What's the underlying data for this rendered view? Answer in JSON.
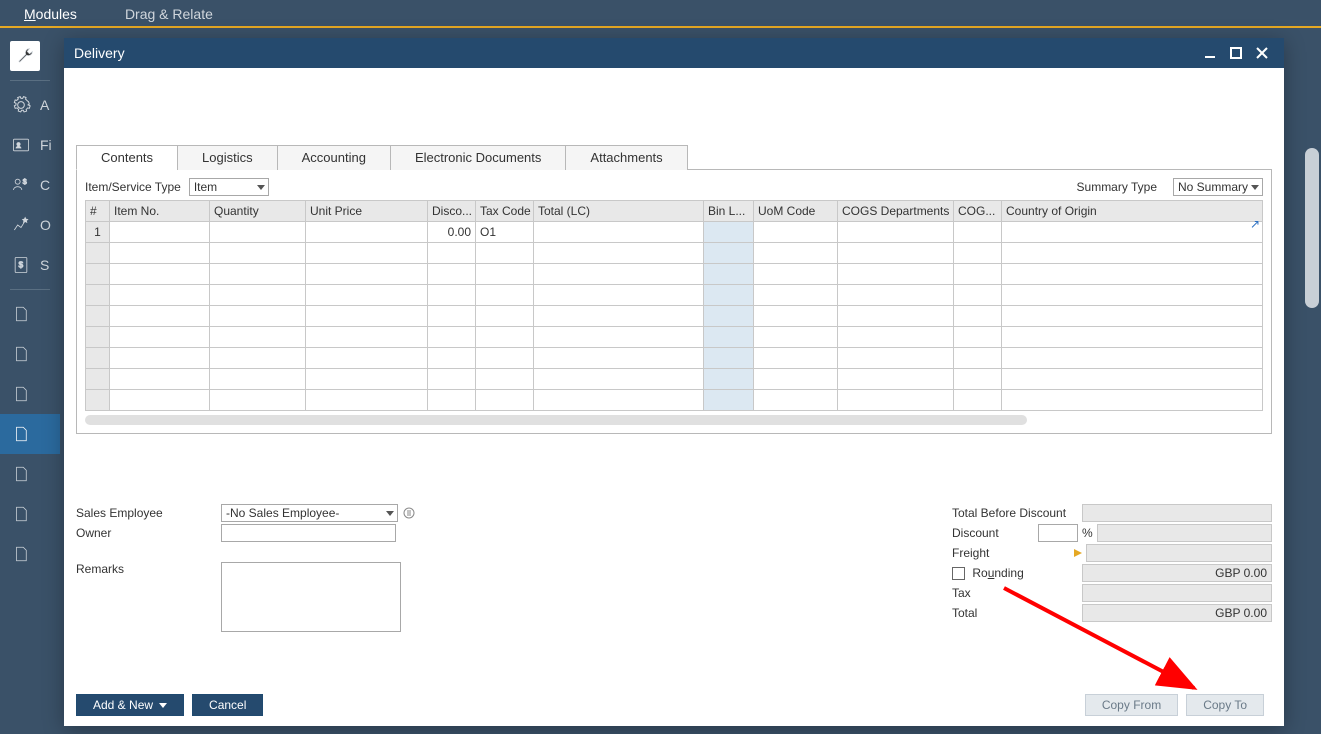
{
  "top_menu": {
    "modules": "Modules",
    "drag": "Drag & Relate"
  },
  "sidebar": {
    "items": [
      {
        "label": ""
      },
      {
        "label": "A"
      },
      {
        "label": "Fi"
      },
      {
        "label": "C"
      },
      {
        "label": "O"
      },
      {
        "label": "S"
      }
    ]
  },
  "window": {
    "title": "Delivery"
  },
  "tabs": {
    "contents": "Contents",
    "logistics": "Logistics",
    "accounting": "Accounting",
    "edocs": "Electronic Documents",
    "attachments": "Attachments"
  },
  "topctrl": {
    "item_type_label": "Item/Service Type",
    "item_type_value": "Item",
    "summary_type_label": "Summary Type",
    "summary_type_value": "No Summary"
  },
  "grid": {
    "headers": [
      "#",
      "Item No.",
      "Quantity",
      "Unit Price",
      "Disco...",
      "Tax Code",
      "Total (LC)",
      "Bin L...",
      "UoM Code",
      "COGS Departments",
      "COG...",
      "Country of Origin"
    ],
    "row1": {
      "num": "1",
      "discount": "0.00",
      "tax": "O1"
    }
  },
  "mid": {
    "sales_emp_label": "Sales Employee",
    "sales_emp_value": "-No Sales Employee-",
    "owner_label": "Owner",
    "owner_value": "",
    "remarks_label": "Remarks",
    "remarks_value": ""
  },
  "totals": {
    "tbd_label": "Total Before Discount",
    "discount_label": "Discount",
    "pct": "%",
    "freight_label": "Freight",
    "rounding_label": "Rounding",
    "rounding_u": "u",
    "rounding_rest": "Ro",
    "rounding_end": "nding",
    "rounding_value": "GBP 0.00",
    "tax_label": "Tax",
    "total_label": "Total",
    "total_value": "GBP 0.00"
  },
  "footer": {
    "add_new": "Add & New",
    "cancel": "Cancel",
    "copy_from": "Copy From",
    "copy_to": "Copy To"
  }
}
